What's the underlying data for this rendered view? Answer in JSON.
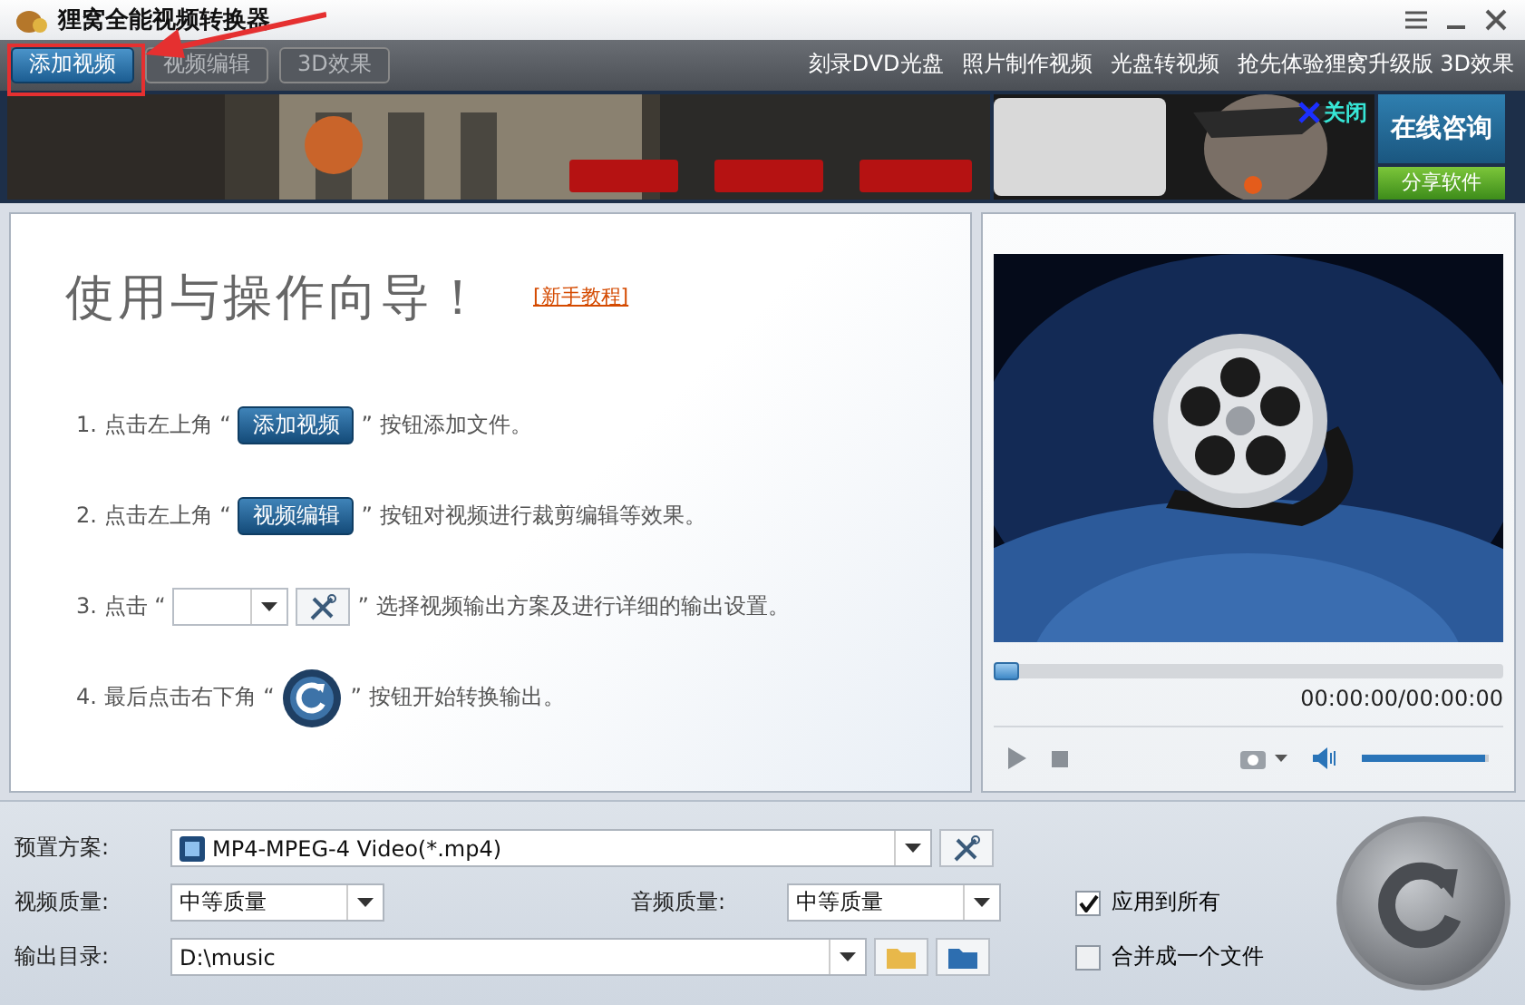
{
  "window": {
    "title": "狸窝全能视频转换器"
  },
  "toolbar": {
    "buttons": [
      {
        "label": "添加视频",
        "disabled": false
      },
      {
        "label": "视频编辑",
        "disabled": true
      },
      {
        "label": "3D效果",
        "disabled": true
      }
    ],
    "links": [
      "刻录DVD光盘",
      "照片制作视频",
      "光盘转视频",
      "抢先体验狸窝升级版 3D效果"
    ]
  },
  "banner": {
    "close": "关闭",
    "consult": "在线咨询",
    "share": "分享软件"
  },
  "guide": {
    "title": "使用与操作向导！",
    "tutorial_link": "[新手教程]",
    "steps": [
      {
        "kind": "button",
        "prefix": "1. 点击左上角 “",
        "label": "添加视频",
        "suffix": "” 按钮添加文件。"
      },
      {
        "kind": "button",
        "prefix": "2. 点击左上角 “",
        "label": "视频编辑",
        "suffix": "” 按钮对视频进行裁剪编辑等效果。"
      },
      {
        "kind": "combo",
        "prefix": "3. 点击 “",
        "suffix": "” 选择视频输出方案及进行详细的输出设置。"
      },
      {
        "kind": "convert",
        "prefix": "4. 最后点击右下角 “",
        "suffix": "” 按钮开始转换输出。"
      }
    ]
  },
  "player": {
    "time": "00:00:00/00:00:00",
    "seek": {
      "level": 0
    },
    "volume": {
      "level": 0.97
    }
  },
  "settings": {
    "preset": {
      "label": "预置方案:",
      "value": "MP4-MPEG-4 Video(*.mp4)"
    },
    "video_quality": {
      "label": "视频质量:",
      "value": "中等质量"
    },
    "audio_quality": {
      "label": "音频质量:",
      "value": "中等质量"
    },
    "output": {
      "label": "输出目录:",
      "value": "D:\\music"
    },
    "options": [
      {
        "label": "应用到所有",
        "checked": true
      },
      {
        "label": "合并成一个文件",
        "checked": false
      }
    ]
  }
}
